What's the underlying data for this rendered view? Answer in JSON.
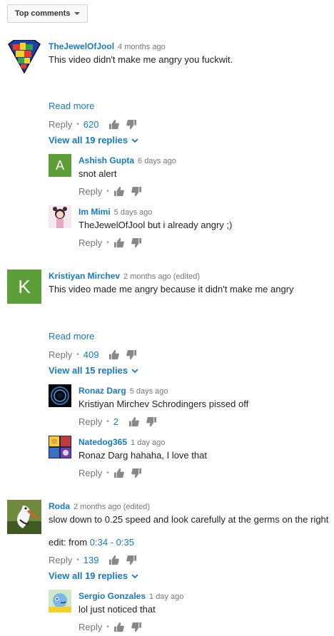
{
  "sort_label": "Top comments",
  "accent": "#167ac6",
  "threads": [
    {
      "author": "TheJewelOfJool",
      "time": "4 months ago",
      "text": "This video didn't make me angry you fuckwit.",
      "read_more": "Read more",
      "reply": "Reply",
      "likes": "620",
      "view_replies": "View all 19 replies",
      "replies": [
        {
          "author": "Ashish Gupta",
          "time": "6 days ago",
          "text": "snot alert",
          "reply": "Reply",
          "avatar_letter": "A",
          "avatar_color": "#5b9e3a"
        },
        {
          "author": "Im Mimi",
          "time": "5 days ago",
          "text": "TheJewelOfJool but i already angry ;)",
          "reply": "Reply"
        }
      ]
    },
    {
      "author": "Kristiyan Mirchev",
      "time": "2 months ago (edited)",
      "text": "This video made me angry because it didn't make me angry",
      "read_more": "Read more",
      "reply": "Reply",
      "likes": "409",
      "avatar_letter": "K",
      "avatar_color": "#5b9e3a",
      "view_replies": "View all 15 replies",
      "replies": [
        {
          "author": "Ronaz Darg",
          "time": "5 days ago",
          "text": "Kristiyan Mirchev Schrodingers pissed off",
          "reply": "Reply",
          "likes": "2"
        },
        {
          "author": "Natedog365",
          "time": "1 day ago",
          "text": "Ronaz Darg hahaha, I love that",
          "reply": "Reply"
        }
      ]
    },
    {
      "author": "Roda",
      "time": "2 months ago (edited)",
      "text": "slow down to 0.25 speed and look carefully at the germs on the right",
      "edit_prefix": "edit: from ",
      "edit_start": "0:34",
      "edit_sep": " - ",
      "edit_end": "0:35",
      "reply": "Reply",
      "likes": "139",
      "view_replies": "View all 19 replies",
      "replies": [
        {
          "author": "Sergio Gonzales",
          "time": "1 day ago",
          "text": "lol just noticed that",
          "reply": "Reply"
        }
      ]
    }
  ]
}
